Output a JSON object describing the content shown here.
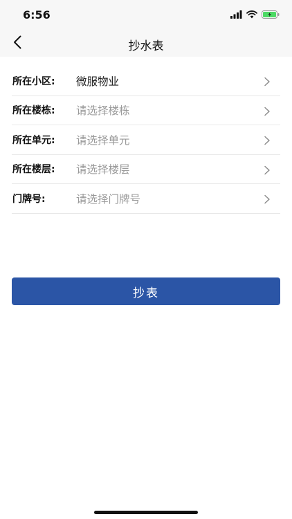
{
  "status_bar": {
    "time": "6:56",
    "icons": [
      "signal-icon",
      "wifi-icon",
      "battery-icon"
    ],
    "battery_color": "#4cd964"
  },
  "nav": {
    "back_icon": "chevron-left-icon",
    "title": "抄水表"
  },
  "form": {
    "rows": [
      {
        "label": "所在小区:",
        "value": "微服物业",
        "placeholder": false
      },
      {
        "label": "所在楼栋:",
        "value": "请选择楼栋",
        "placeholder": true
      },
      {
        "label": "所在单元:",
        "value": "请选择单元",
        "placeholder": true
      },
      {
        "label": "所在楼层:",
        "value": "请选择楼层",
        "placeholder": true
      },
      {
        "label": "门牌号:",
        "value": "请选择门牌号",
        "placeholder": true
      }
    ]
  },
  "submit": {
    "label": "抄表",
    "color": "#2b55a6"
  }
}
